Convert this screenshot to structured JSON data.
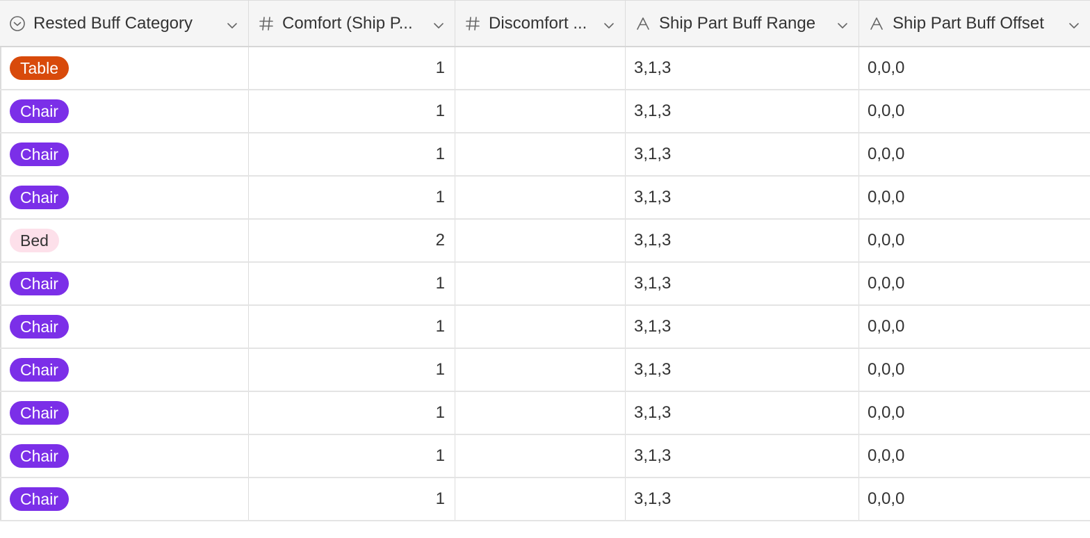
{
  "columns": [
    {
      "label": "Rested Buff Category",
      "icon": "select-circle-icon"
    },
    {
      "label": "Comfort (Ship P...",
      "icon": "hash-icon"
    },
    {
      "label": "Discomfort ...",
      "icon": "hash-icon"
    },
    {
      "label": "Ship Part Buff Range",
      "icon": "text-type-icon"
    },
    {
      "label": "Ship Part Buff Offset",
      "icon": "text-type-icon"
    }
  ],
  "categories": {
    "Table": {
      "bg": "#d84a0b",
      "fg": "#ffffff"
    },
    "Chair": {
      "bg": "#7b2fe8",
      "fg": "#ffffff"
    },
    "Bed": {
      "bg": "#fde0ea",
      "fg": "#333333"
    }
  },
  "rows": [
    {
      "category": "Table",
      "comfort": "1",
      "discomfort": "",
      "range": "3,1,3",
      "offset": "0,0,0"
    },
    {
      "category": "Chair",
      "comfort": "1",
      "discomfort": "",
      "range": "3,1,3",
      "offset": "0,0,0"
    },
    {
      "category": "Chair",
      "comfort": "1",
      "discomfort": "",
      "range": "3,1,3",
      "offset": "0,0,0"
    },
    {
      "category": "Chair",
      "comfort": "1",
      "discomfort": "",
      "range": "3,1,3",
      "offset": "0,0,0"
    },
    {
      "category": "Bed",
      "comfort": "2",
      "discomfort": "",
      "range": "3,1,3",
      "offset": "0,0,0"
    },
    {
      "category": "Chair",
      "comfort": "1",
      "discomfort": "",
      "range": "3,1,3",
      "offset": "0,0,0"
    },
    {
      "category": "Chair",
      "comfort": "1",
      "discomfort": "",
      "range": "3,1,3",
      "offset": "0,0,0"
    },
    {
      "category": "Chair",
      "comfort": "1",
      "discomfort": "",
      "range": "3,1,3",
      "offset": "0,0,0"
    },
    {
      "category": "Chair",
      "comfort": "1",
      "discomfort": "",
      "range": "3,1,3",
      "offset": "0,0,0"
    },
    {
      "category": "Chair",
      "comfort": "1",
      "discomfort": "",
      "range": "3,1,3",
      "offset": "0,0,0"
    },
    {
      "category": "Chair",
      "comfort": "1",
      "discomfort": "",
      "range": "3,1,3",
      "offset": "0,0,0"
    }
  ]
}
